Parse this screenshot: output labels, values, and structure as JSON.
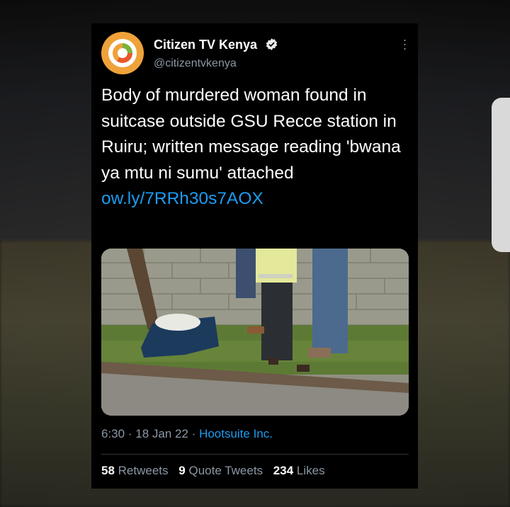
{
  "tweet": {
    "account_name": "Citizen TV Kenya",
    "handle": "@citizentvkenya",
    "text": "Body of murdered woman found in suitcase outside GSU Recce station in Ruiru; written message reading 'bwana ya mtu ni sumu' attached",
    "link": "ow.ly/7RRh30s7AOX",
    "time": "6:30",
    "date": "18 Jan 22",
    "source": "Hootsuite Inc.",
    "meta_separator": "·",
    "stats": {
      "retweets_count": "58",
      "retweets_label": "Retweets",
      "quotes_count": "9",
      "quotes_label": "Quote Tweets",
      "likes_count": "234",
      "likes_label": "Likes"
    }
  },
  "icons": {
    "avatar": "citizen-tv-logo",
    "verified": "verified-badge-icon",
    "more": "more-options-icon"
  },
  "colors": {
    "background": "#000000",
    "link": "#1d9bf0",
    "muted": "#8b98a5",
    "text": "#ffffff"
  }
}
